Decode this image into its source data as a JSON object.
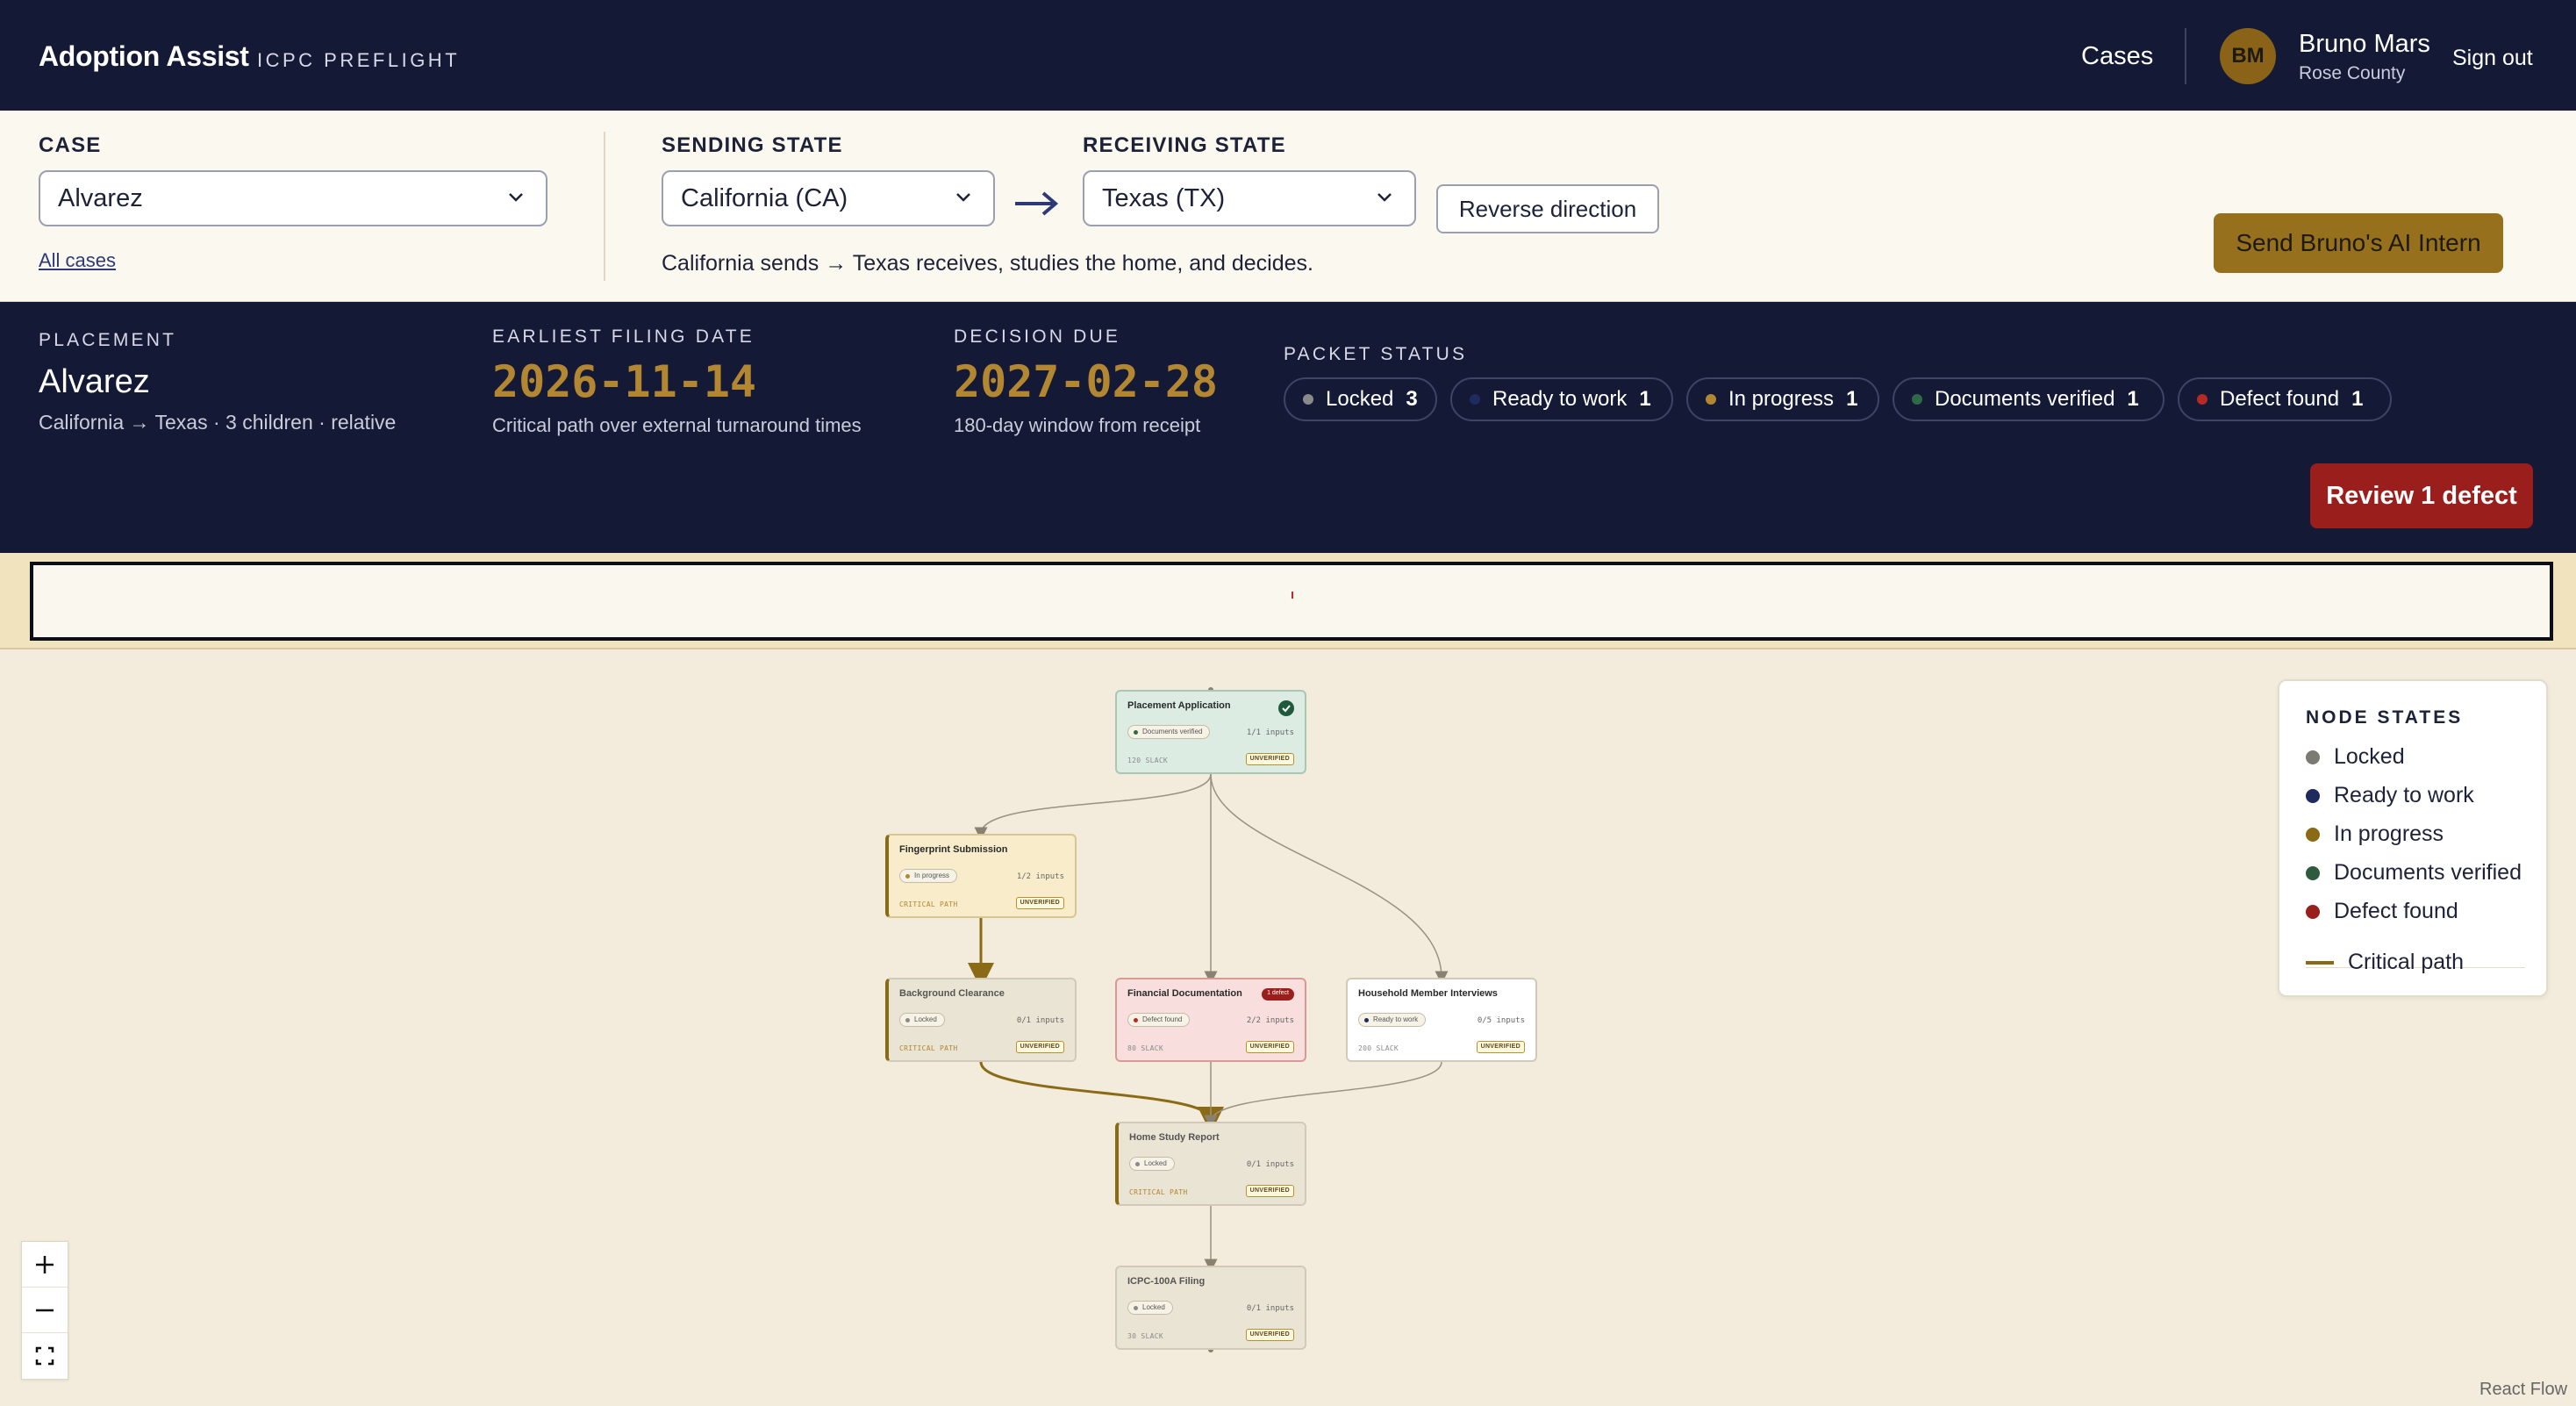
{
  "app": {
    "brand": "Adoption Assist",
    "subtitle": "ICPC PREFLIGHT"
  },
  "nav": {
    "cases": "Cases",
    "user_initials": "BM",
    "user_name": "Bruno Mars",
    "user_county": "Rose County",
    "sign_out": "Sign out"
  },
  "case_bar": {
    "case_label": "CASE",
    "case_value": "Alvarez",
    "all_cases": "All cases",
    "sending_label": "SENDING STATE",
    "sending_value": "California (CA)",
    "receiving_label": "RECEIVING STATE",
    "receiving_value": "Texas (TX)",
    "reverse": "Reverse direction",
    "direction_text": "California sends → Texas receives, studies the home, and decides.",
    "ai_button": "Send Bruno's AI Intern"
  },
  "summary": {
    "placement_label": "PLACEMENT",
    "placement_value": "Alvarez",
    "placement_sub": "California → Texas · 3 children · relative",
    "filing_label": "EARLIEST FILING DATE",
    "filing_value": "2026-11-14",
    "filing_sub": "Critical path over external turnaround times",
    "due_label": "DECISION DUE",
    "due_value": "2027-02-28",
    "due_sub": "180-day window from receipt",
    "status_label": "PACKET STATUS",
    "chips": [
      {
        "label": "Locked",
        "count": "3",
        "color": "#8a8a8a"
      },
      {
        "label": "Ready to work",
        "count": "1",
        "color": "#1f2a5e"
      },
      {
        "label": "In progress",
        "count": "1",
        "color": "#b38631"
      },
      {
        "label": "Documents verified",
        "count": "1",
        "color": "#2e6a46"
      },
      {
        "label": "Defect found",
        "count": "1",
        "color": "#b52a22"
      }
    ],
    "review_button": "Review 1 defect"
  },
  "flow": {
    "nodes": [
      {
        "title": "Placement Application",
        "state": "Documents verified",
        "inputs": "1/1 inputs",
        "slack": "120 SLACK",
        "tag": "UNVERIFIED"
      },
      {
        "title": "Fingerprint Submission",
        "state": "In progress",
        "inputs": "1/2 inputs",
        "slack": "CRITICAL PATH",
        "tag": "UNVERIFIED"
      },
      {
        "title": "Background Clearance",
        "state": "Locked",
        "inputs": "0/1 inputs",
        "slack": "CRITICAL PATH",
        "tag": "UNVERIFIED"
      },
      {
        "title": "Financial Documentation",
        "state": "Defect found",
        "inputs": "2/2 inputs",
        "slack": "80 SLACK",
        "tag": "UNVERIFIED",
        "badge": "1 defect"
      },
      {
        "title": "Household Member Interviews",
        "state": "Ready to work",
        "inputs": "0/5 inputs",
        "slack": "200 SLACK",
        "tag": "UNVERIFIED"
      },
      {
        "title": "Home Study Report",
        "state": "Locked",
        "inputs": "0/1 inputs",
        "slack": "CRITICAL PATH",
        "tag": "UNVERIFIED"
      },
      {
        "title": "ICPC-100A Filing",
        "state": "Locked",
        "inputs": "0/1 inputs",
        "slack": "30 SLACK",
        "tag": "UNVERIFIED"
      }
    ]
  },
  "legend": {
    "title": "NODE STATES",
    "items": [
      {
        "label": "Locked",
        "color": "#7b7b74"
      },
      {
        "label": "Ready to work",
        "color": "#1f2a5e"
      },
      {
        "label": "In progress",
        "color": "#8a6a14"
      },
      {
        "label": "Documents verified",
        "color": "#2e5a3d"
      },
      {
        "label": "Defect found",
        "color": "#9a1f1c"
      }
    ],
    "critical_path": "Critical path"
  },
  "attribution": "React Flow",
  "colors": {
    "navy": "#141a36",
    "gold": "#96701c",
    "defect": "#9a1f1c"
  }
}
